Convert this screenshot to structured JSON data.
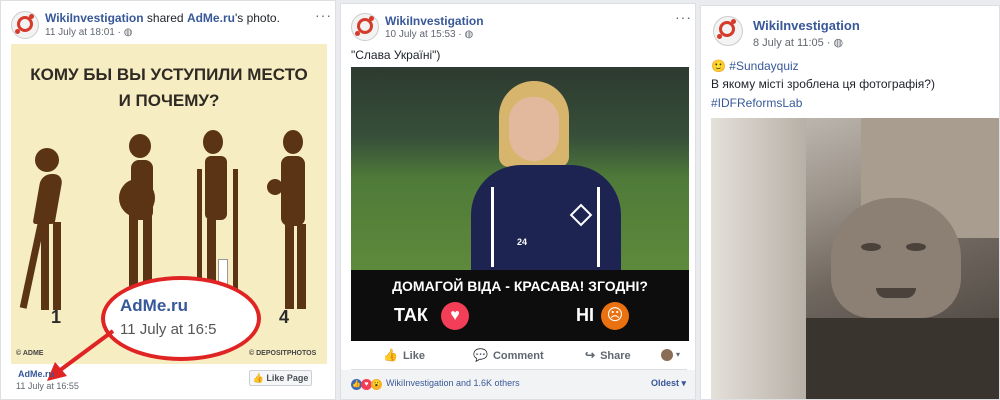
{
  "posts": [
    {
      "page_name": "WikiInvestigation",
      "shared_text": " shared ",
      "shared_source": "AdMe.ru",
      "shared_suffix": "'s photo.",
      "timestamp": "11 July at 18:01",
      "image": {
        "title_line1": "КОМУ БЫ ВЫ УСТУПИЛИ МЕСТО",
        "title_line2": "И ПОЧЕМУ?",
        "numbers": [
          "1",
          "4"
        ],
        "credit_left": "© ADME",
        "credit_right": "© DEPOSITPHOTOS",
        "zoom_name": "AdMe.ru",
        "zoom_time": "11 July at 16:5"
      },
      "source_name": "AdMe.ru",
      "source_time": "11 July at 16:55",
      "like_page_label": "Like Page",
      "arrow_color": "#e02323"
    },
    {
      "page_name": "WikiInvestigation",
      "timestamp": "10 July at 15:53",
      "caption": "\"Слава Україні\")",
      "image": {
        "question": "ДОМАГОЙ ВІДА - КРАСАВА! ЗГОДНІ?",
        "yes": "ТАК",
        "no": "НІ",
        "jersey_number": "24"
      },
      "actions": {
        "like": "Like",
        "comment": "Comment",
        "share": "Share"
      },
      "reactors": "WikiInvestigation and 1.6K others",
      "sort_label": "Oldest"
    },
    {
      "page_name": "WikiInvestigation",
      "timestamp": "8 July at 11:05",
      "hashtag1": "#Sundayquiz",
      "question": "В якому місті зроблена ця фотографія?)",
      "hashtag2": "#IDFReformsLab"
    }
  ],
  "colors": {
    "link": "#385898",
    "love": "#f33e58",
    "angry": "#e9710f",
    "facebook_blue": "#4267b2"
  }
}
